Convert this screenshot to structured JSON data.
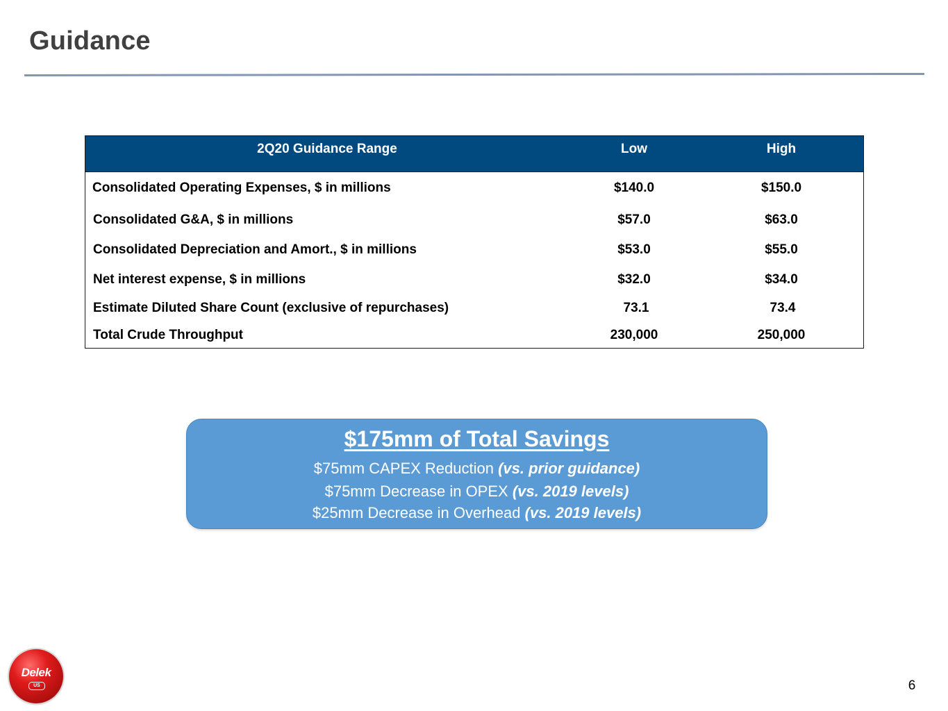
{
  "slide": {
    "title": "Guidance",
    "page_number": "6"
  },
  "table": {
    "headers": {
      "range": "2Q20 Guidance Range",
      "low": "Low",
      "high": "High"
    },
    "rows": [
      {
        "label": "Consolidated Operating Expenses, $ in millions",
        "low": "$140.0",
        "high": "$150.0"
      },
      {
        "label": "Consolidated G&A, $ in millions",
        "low": "$57.0",
        "high": "$63.0"
      },
      {
        "label": "Consolidated Depreciation and Amort., $ in millions",
        "low": "$53.0",
        "high": "$55.0"
      },
      {
        "label": "Net interest expense, $ in millions",
        "low": "$32.0",
        "high": "$34.0"
      },
      {
        "label": "Estimate Diluted Share Count (exclusive of repurchases)",
        "low": "73.1",
        "high": "73.4"
      },
      {
        "label": "Total Crude Throughput",
        "low": "230,000",
        "high": "250,000"
      }
    ]
  },
  "savings": {
    "title": "$175mm of Total Savings",
    "lines": [
      {
        "text": "$75mm CAPEX Reduction ",
        "note": "(vs. prior guidance)"
      },
      {
        "text": "$75mm Decrease in OPEX ",
        "note": "(vs. 2019 levels)"
      },
      {
        "text": "$25mm Decrease in Overhead ",
        "note": "(vs. 2019 levels)"
      }
    ]
  },
  "logo": {
    "name": "Delek",
    "sub": "US",
    "icon": "delek-logo-icon",
    "color": "#e01b1b"
  },
  "colors": {
    "header_bg": "#004a80",
    "savings_bg": "#5b9bd5",
    "title_text": "#404040",
    "rule": "#8497b0"
  }
}
